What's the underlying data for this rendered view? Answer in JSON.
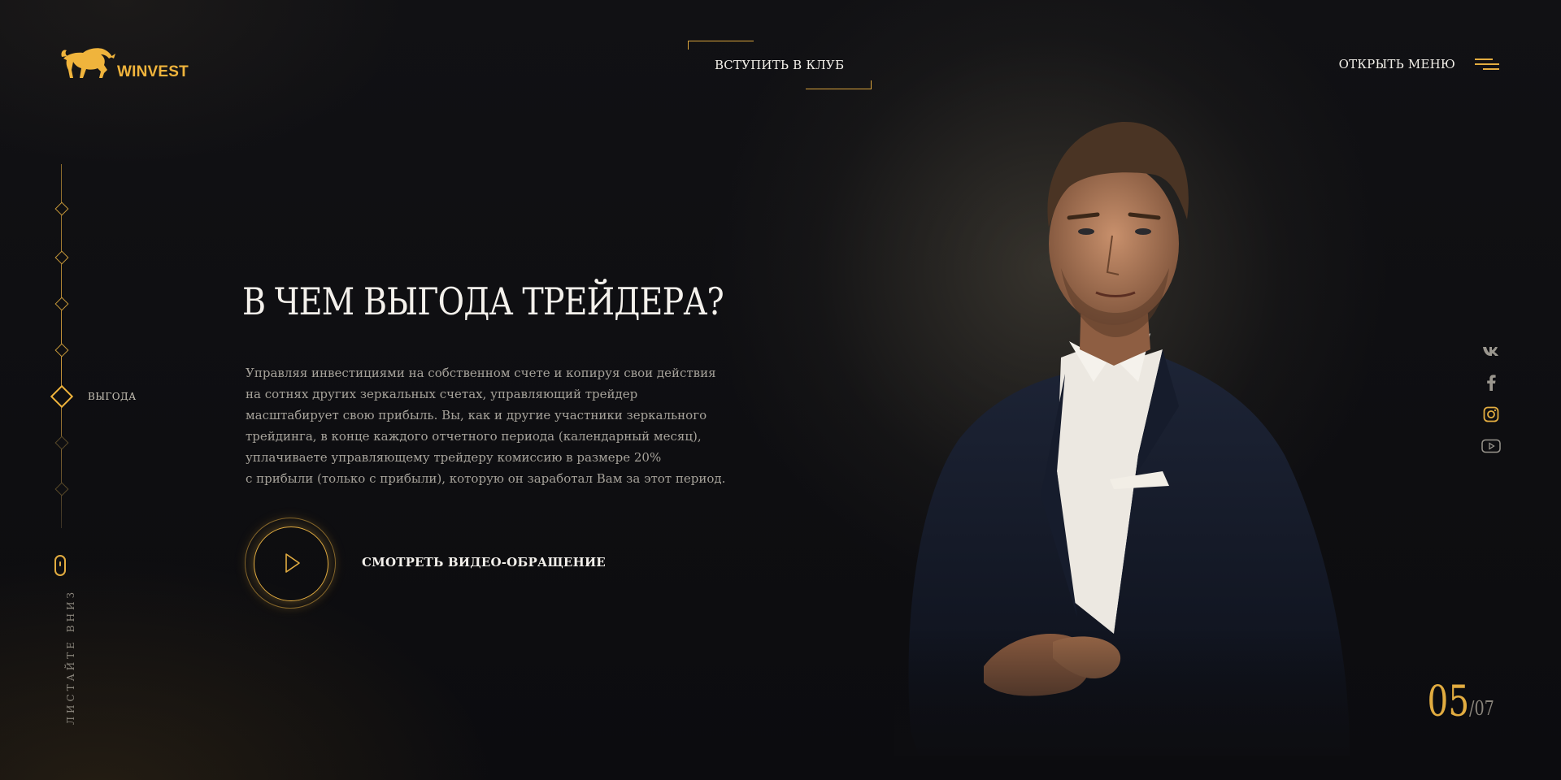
{
  "brand": {
    "name": "WINVEST",
    "color": "#f0b43c"
  },
  "header": {
    "join_label": "ВСТУПИТЬ В КЛУБ",
    "menu_label": "ОТКРЫТЬ МЕНЮ"
  },
  "sidebar": {
    "active_index": 4,
    "active_label": "ВЫГОДА",
    "items_count": 7,
    "scroll_hint": "ЛИСТАЙТЕ ВНИЗ"
  },
  "main": {
    "title": "В ЧЕМ ВЫГОДА ТРЕЙДЕРА?",
    "description": [
      "Управляя инвестициями на собственном счете и копируя свои действия",
      "на сотнях других зеркальных счетах, управляющий трейдер",
      "масштабирует свою прибыль. Вы, как и другие участники зеркального",
      "трейдинга, в конце каждого отчетного периода (календарный месяц),",
      "уплачиваете управляющему трейдеру комиссию в размере 20%",
      "с прибыли (только с прибыли), которую он заработал Вам за этот период."
    ],
    "video_label": "СМОТРЕТЬ ВИДЕО-ОБРАЩЕНИЕ"
  },
  "social": [
    "vk-icon",
    "facebook-icon",
    "instagram-icon",
    "youtube-icon"
  ],
  "pagination": {
    "current": "05",
    "total": "/07"
  },
  "colors": {
    "accent": "#e2ac40",
    "background": "#0d0d10",
    "text": "#f4f1ec",
    "muted": "#a6a29a"
  }
}
